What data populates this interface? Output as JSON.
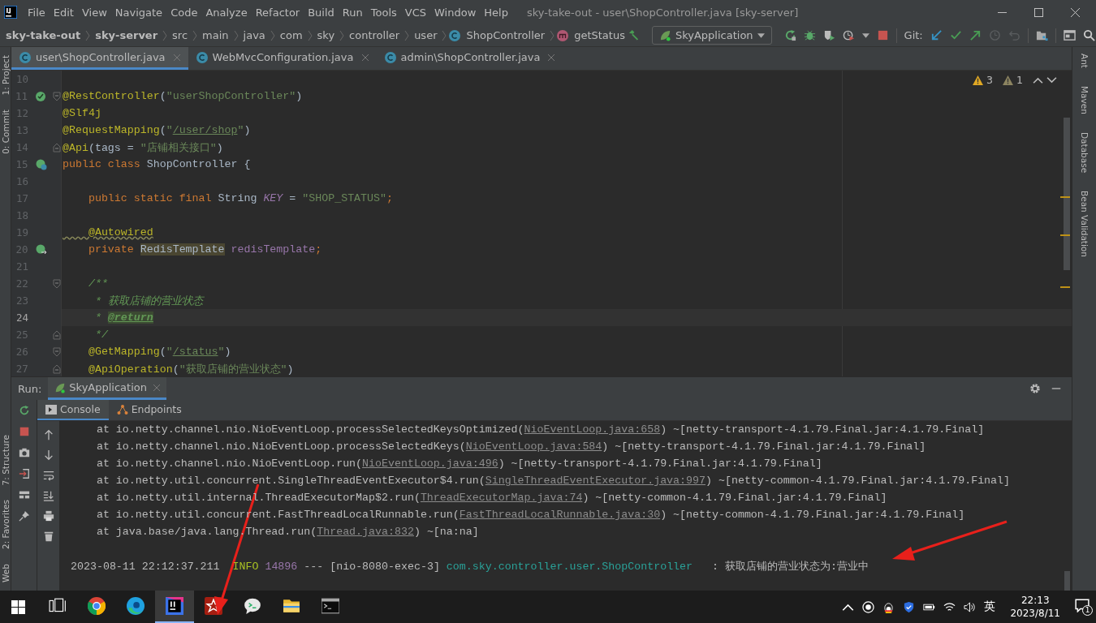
{
  "window": {
    "title": "sky-take-out - user\\ShopController.java [sky-server]"
  },
  "menu": {
    "items": [
      "File",
      "Edit",
      "View",
      "Navigate",
      "Code",
      "Analyze",
      "Refactor",
      "Build",
      "Run",
      "Tools",
      "VCS",
      "Window",
      "Help"
    ]
  },
  "breadcrumb": [
    {
      "label": "sky-take-out",
      "kind": "project"
    },
    {
      "label": "sky-server",
      "kind": "project"
    },
    {
      "label": "src",
      "kind": "dir"
    },
    {
      "label": "main",
      "kind": "dir"
    },
    {
      "label": "java",
      "kind": "dir"
    },
    {
      "label": "com",
      "kind": "dir"
    },
    {
      "label": "sky",
      "kind": "dir"
    },
    {
      "label": "controller",
      "kind": "dir"
    },
    {
      "label": "user",
      "kind": "dir"
    },
    {
      "label": "ShopController",
      "kind": "class"
    },
    {
      "label": "getStatus",
      "kind": "method"
    }
  ],
  "toolbar": {
    "run_config": "SkyApplication",
    "vcs_label": "Git:"
  },
  "editor_tabs": [
    {
      "label": "user\\ShopController.java",
      "selected": true
    },
    {
      "label": "WebMvcConfiguration.java",
      "selected": false
    },
    {
      "label": "admin\\ShopController.java",
      "selected": false
    }
  ],
  "left_tool_tabs": {
    "top": [
      "1: Project",
      "0: Commit"
    ],
    "bottom": [
      "7: Structure",
      "2: Favorites",
      "Web"
    ]
  },
  "right_tool_tabs": [
    "Ant",
    "Maven",
    "Database",
    "Bean Validation"
  ],
  "inspections": {
    "warnings": "3",
    "weak_warnings": "1"
  },
  "editor": {
    "lines": [
      {
        "number": "10",
        "current": false
      },
      {
        "number": "11",
        "current": false,
        "gutter": {
          "kind": "bean"
        },
        "fold": {
          "kind": "start"
        },
        "tokens": [
          {
            "kind": "annotation",
            "text": "@RestController"
          },
          {
            "kind": "plain",
            "text": "("
          },
          {
            "kind": "string",
            "text": "\"userShopController\""
          },
          {
            "kind": "plain",
            "text": ")"
          }
        ]
      },
      {
        "number": "12",
        "current": false,
        "tokens": [
          {
            "kind": "annotation",
            "text": "@Slf4j"
          }
        ]
      },
      {
        "number": "13",
        "current": false,
        "tokens": [
          {
            "kind": "annotation",
            "text": "@RequestMapping"
          },
          {
            "kind": "plain",
            "text": "("
          },
          {
            "kind": "string",
            "text": "\""
          },
          {
            "kind": "link",
            "text": "/user/shop"
          },
          {
            "kind": "string",
            "text": "\""
          },
          {
            "kind": "plain",
            "text": ")"
          }
        ]
      },
      {
        "number": "14",
        "current": false,
        "fold": {
          "kind": "end"
        },
        "tokens": [
          {
            "kind": "annotation",
            "text": "@Api"
          },
          {
            "kind": "plain",
            "text": "(tags = "
          },
          {
            "kind": "string",
            "text": "\"店铺相关接口\""
          },
          {
            "kind": "plain",
            "text": ")"
          }
        ]
      },
      {
        "number": "15",
        "current": false,
        "gutter": {
          "kind": "class"
        },
        "tokens": [
          {
            "kind": "keyword",
            "text": "public class "
          },
          {
            "kind": "plain",
            "text": "ShopController {"
          }
        ]
      },
      {
        "number": "16",
        "current": false
      },
      {
        "number": "17",
        "current": false,
        "tokens": [
          {
            "kind": "keyword",
            "text": "    public static final "
          },
          {
            "kind": "plain",
            "text": "String "
          },
          {
            "kind": "constant",
            "text": "KEY"
          },
          {
            "kind": "plain",
            "text": " = "
          },
          {
            "kind": "string",
            "text": "\"SHOP_STATUS\""
          },
          {
            "kind": "keyword",
            "text": ";"
          }
        ]
      },
      {
        "number": "18",
        "current": false
      },
      {
        "number": "19",
        "current": false,
        "tokens": [
          {
            "kind": "warn-annotation",
            "text": "    @Autowired"
          }
        ]
      },
      {
        "number": "20",
        "current": false,
        "gutter": {
          "kind": "autowire"
        },
        "tokens": [
          {
            "kind": "keyword",
            "text": "    private "
          },
          {
            "kind": "highlight",
            "text": "RedisTemplate"
          },
          {
            "kind": "field",
            "text": " redisTemplate"
          },
          {
            "kind": "keyword",
            "text": ";"
          }
        ]
      },
      {
        "number": "21",
        "current": false
      },
      {
        "number": "22",
        "current": false,
        "fold": {
          "kind": "start"
        },
        "tokens": [
          {
            "kind": "comment",
            "text": "    /**"
          }
        ]
      },
      {
        "number": "23",
        "current": false,
        "tokens": [
          {
            "kind": "comment",
            "text": "     * 获取店铺的营业状态"
          }
        ]
      },
      {
        "number": "24",
        "current": true,
        "tokens": [
          {
            "kind": "comment",
            "text": "     * "
          },
          {
            "kind": "doctag",
            "text": "@return"
          }
        ]
      },
      {
        "number": "25",
        "current": false,
        "fold": {
          "kind": "end"
        },
        "tokens": [
          {
            "kind": "comment",
            "text": "     */"
          }
        ]
      },
      {
        "number": "26",
        "current": false,
        "fold": {
          "kind": "start"
        },
        "tokens": [
          {
            "kind": "annotation",
            "text": "    @GetMapping"
          },
          {
            "kind": "plain",
            "text": "("
          },
          {
            "kind": "string",
            "text": "\""
          },
          {
            "kind": "link",
            "text": "/status"
          },
          {
            "kind": "string",
            "text": "\""
          },
          {
            "kind": "plain",
            "text": ")"
          }
        ]
      },
      {
        "number": "27",
        "current": false,
        "fold": {
          "kind": "end"
        },
        "tokens": [
          {
            "kind": "annotation",
            "text": "    @ApiOperation"
          },
          {
            "kind": "plain",
            "text": "("
          },
          {
            "kind": "string",
            "text": "\"获取店铺的营业状态\""
          },
          {
            "kind": "plain",
            "text": ")"
          }
        ]
      }
    ]
  },
  "run_panel": {
    "label": "Run:",
    "tabs": [
      {
        "label": "SkyApplication",
        "selected": true
      }
    ],
    "console_tabs": [
      {
        "label": "Console",
        "selected": true
      },
      {
        "label": "Endpoints",
        "selected": false
      }
    ],
    "lines": [
      {
        "segments": [
          {
            "kind": "plain",
            "text": "    at io.netty.channel.nio.NioEventLoop.processSelectedKeysOptimized("
          },
          {
            "kind": "link",
            "text": "NioEventLoop.java:658"
          },
          {
            "kind": "plain",
            "text": ") ~[netty-transport-4.1.79.Final.jar:4.1.79.Final]"
          }
        ]
      },
      {
        "segments": [
          {
            "kind": "plain",
            "text": "    at io.netty.channel.nio.NioEventLoop.processSelectedKeys("
          },
          {
            "kind": "link",
            "text": "NioEventLoop.java:584"
          },
          {
            "kind": "plain",
            "text": ") ~[netty-transport-4.1.79.Final.jar:4.1.79.Final]"
          }
        ]
      },
      {
        "segments": [
          {
            "kind": "plain",
            "text": "    at io.netty.channel.nio.NioEventLoop.run("
          },
          {
            "kind": "link",
            "text": "NioEventLoop.java:496"
          },
          {
            "kind": "plain",
            "text": ") ~[netty-transport-4.1.79.Final.jar:4.1.79.Final]"
          }
        ]
      },
      {
        "segments": [
          {
            "kind": "plain",
            "text": "    at io.netty.util.concurrent.SingleThreadEventExecutor$4.run("
          },
          {
            "kind": "link",
            "text": "SingleThreadEventExecutor.java:997"
          },
          {
            "kind": "plain",
            "text": ") ~[netty-common-4.1.79.Final.jar:4.1.79.Final]"
          }
        ]
      },
      {
        "segments": [
          {
            "kind": "plain",
            "text": "    at io.netty.util.internal.ThreadExecutorMap$2.run("
          },
          {
            "kind": "link",
            "text": "ThreadExecutorMap.java:74"
          },
          {
            "kind": "plain",
            "text": ") ~[netty-common-4.1.79.Final.jar:4.1.79.Final]"
          }
        ]
      },
      {
        "segments": [
          {
            "kind": "plain",
            "text": "    at io.netty.util.concurrent.FastThreadLocalRunnable.run("
          },
          {
            "kind": "link",
            "text": "FastThreadLocalRunnable.java:30"
          },
          {
            "kind": "plain",
            "text": ") ~[netty-common-4.1.79.Final.jar:4.1.79.Final]"
          }
        ]
      },
      {
        "segments": [
          {
            "kind": "plain",
            "text": "    at java.base/java.lang.Thread.run("
          },
          {
            "kind": "link",
            "text": "Thread.java:832"
          },
          {
            "kind": "plain",
            "text": ") ~[na:na]"
          }
        ]
      },
      {
        "kind": "log",
        "segments": [
          {
            "kind": "plain",
            "text": "2023-08-11 22:12:37.211  "
          },
          {
            "kind": "info",
            "text": "INFO"
          },
          {
            "kind": "pid",
            "text": " 14896"
          },
          {
            "kind": "plain",
            "text": " --- [nio-8080-exec-3] "
          },
          {
            "kind": "logger",
            "text": "com.sky.controller.user.ShopController"
          },
          {
            "kind": "plain",
            "text": "   : 获取店铺的营业状态为:营业中"
          }
        ]
      }
    ]
  },
  "taskbar": {
    "apps": [
      {
        "kind": "taskview",
        "selected": false
      },
      {
        "kind": "chrome",
        "selected": false
      },
      {
        "kind": "edge",
        "selected": false
      },
      {
        "kind": "intellij",
        "selected": true
      },
      {
        "kind": "redis",
        "selected": false
      },
      {
        "kind": "chat",
        "selected": false
      },
      {
        "kind": "folder",
        "selected": false
      },
      {
        "kind": "terminal",
        "selected": false
      }
    ],
    "tray": {
      "ime": "英",
      "time": "22:13",
      "date": "2023/8/11",
      "notifications": "1"
    }
  }
}
